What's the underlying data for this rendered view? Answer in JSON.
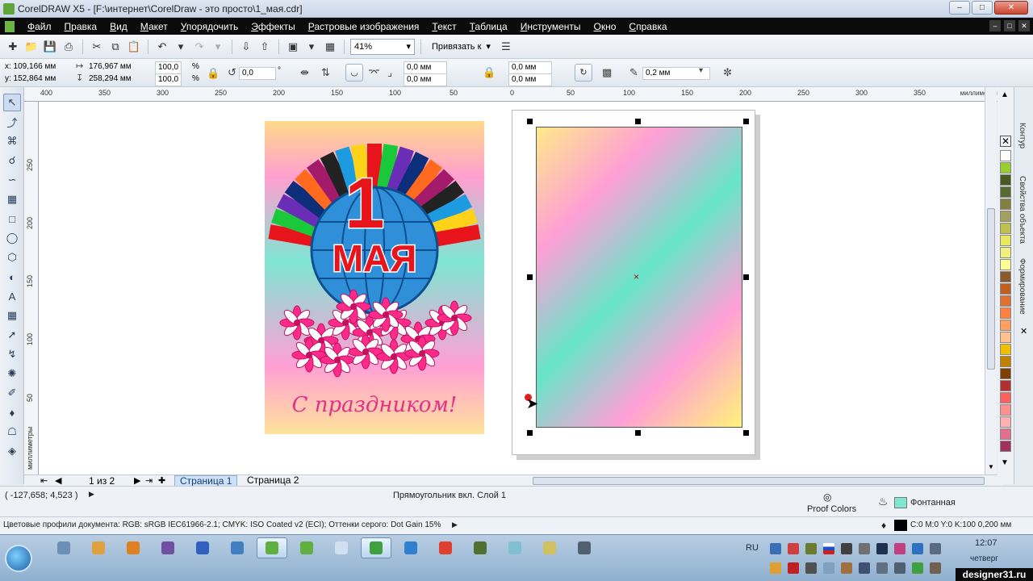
{
  "window": {
    "title": "CorelDRAW X5 - [F:\\интернет\\CorelDraw - это просто\\1_мая.cdr]"
  },
  "menu": [
    "Файл",
    "Правка",
    "Вид",
    "Макет",
    "Упорядочить",
    "Эффекты",
    "Растровые изображения",
    "Текст",
    "Таблица",
    "Инструменты",
    "Окно",
    "Справка"
  ],
  "toolbar": {
    "zoom": "41%",
    "snap_label": "Привязать к"
  },
  "propbar": {
    "x": "x: 109,166 мм",
    "y": "y: 152,864 мм",
    "w": "176,967 мм",
    "h": "258,294 мм",
    "scale_x": "100,0",
    "scale_y": "100,0",
    "pct": "%",
    "angle": "0,0",
    "deg": "°",
    "c1": "0,0 мм",
    "c2": "0,0 мм",
    "c3": "0,0 мм",
    "c4": "0,0 мм",
    "outline": "0,2 мм"
  },
  "rulers": {
    "h_ticks": [
      "400",
      "350",
      "300",
      "250",
      "200",
      "150",
      "100",
      "50",
      "0",
      "50",
      "100",
      "150",
      "200",
      "250",
      "300",
      "350"
    ],
    "v_ticks": [
      "250",
      "200",
      "150",
      "100",
      "50"
    ],
    "h_unit": "миллиметры",
    "v_unit": "миллиметры"
  },
  "pages": {
    "counter": "1 из 2",
    "tabs": [
      "Страница 1",
      "Страница 2"
    ]
  },
  "status": {
    "coords": "( -127,658; 4,523 )",
    "object": "Прямоугольник вкл. Слой 1",
    "proof": "Proof Colors",
    "fill": "Фонтанная",
    "profiles": "Цветовые профили документа: RGB: sRGB IEC61966-2.1; CMYK: ISO Coated v2 (ECI); Оттенки серого: Dot Gain 15%",
    "outline": "C:0 M:0 Y:0 K:100  0,200 мм"
  },
  "dockers": [
    "Контур",
    "Свойства объекта",
    "Формирование"
  ],
  "palette": [
    "#ffffff",
    "#9acd32",
    "#4a5a1e",
    "#556b2f",
    "#808040",
    "#a0a060",
    "#c0c050",
    "#e8e860",
    "#f0f080",
    "#ffff99",
    "#8b5a2b",
    "#c06020",
    "#e07030",
    "#ff8040",
    "#ffa060",
    "#ffc090",
    "#f0c000",
    "#c08000",
    "#804000",
    "#b03030",
    "#ff6060",
    "#ff9090",
    "#ffb0b0",
    "#e07090",
    "#a03060"
  ],
  "taskbar": {
    "lang": "RU",
    "time": "12:07",
    "day": "четверг",
    "watermark": "designer31.ru",
    "apps": [
      "#6b8fb5",
      "#e0a040",
      "#e08020",
      "#7050a0",
      "#3060c0",
      "#4080c0",
      "#60b040",
      "#60b040",
      "#d0e0f0",
      "#40a040",
      "#3080d0",
      "#e04030",
      "#507030",
      "#80c0d0",
      "#d0c060",
      "#506070"
    ]
  },
  "card_text": {
    "one": "1",
    "may": "МАЯ",
    "greeting": "С праздником!"
  }
}
